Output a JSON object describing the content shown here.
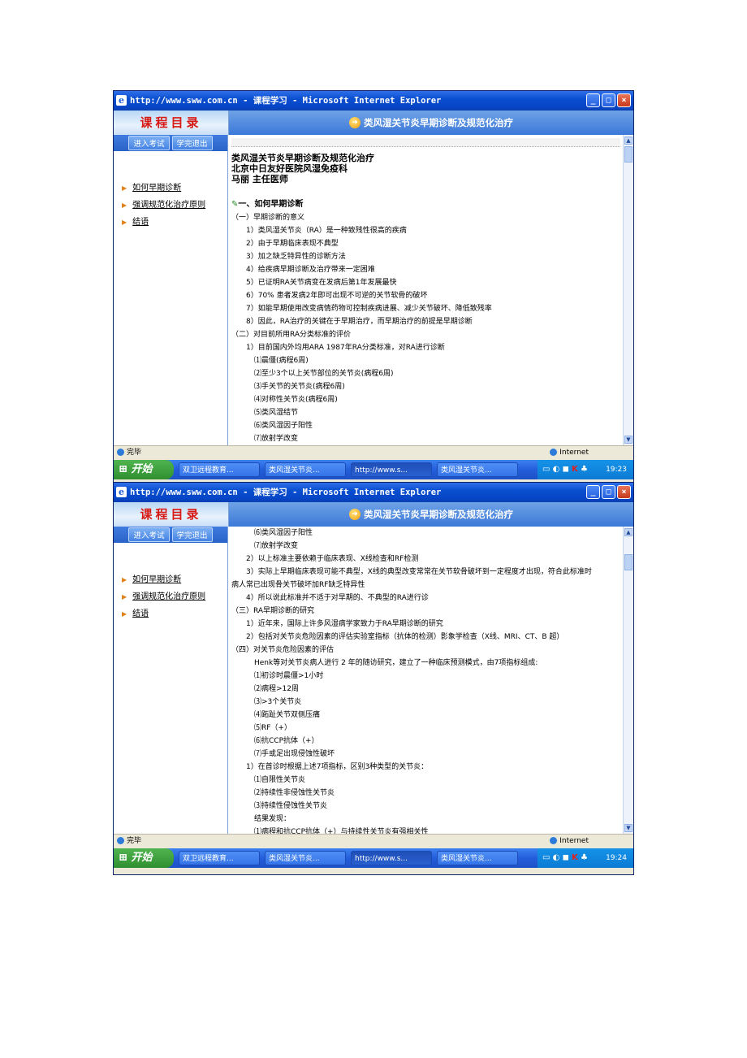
{
  "window": {
    "title": "http://www.sww.com.cn - 课程学习 - Microsoft Internet Explorer",
    "minimize": "_",
    "maximize": "□",
    "close": "×"
  },
  "app": {
    "menu_heading": "课程目录",
    "course_title": "类风湿关节炎早期诊断及规范化治疗",
    "buttons": {
      "exam": "进入考试",
      "exit": "学完退出"
    },
    "nav": [
      "如何早期诊断",
      "强调规范化治疗原则",
      "结语"
    ]
  },
  "content1": {
    "title1": "类风湿关节炎早期诊断及规范化治疗",
    "title2": "北京中日友好医院风湿免疫科",
    "title3": "马丽  主任医师",
    "section_heading": "一、如何早期诊断",
    "lines": [
      "（一）早期诊断的意义",
      "1）类风湿关节炎（RA）是一种致残性很高的疾病",
      "2）由于早期临床表现不典型",
      "3）加之缺乏特异性的诊断方法",
      "4）给疾病早期诊断及治疗带来一定困难",
      "5）已证明RA关节病变在发病后第1年发展最快",
      "6）70% 患者发病2年即可出现不可逆的关节软骨的破坏",
      "7）如能早期使用改变病情药物可控制疾病进展、减少关节破坏、降低致残率",
      "8）因此，RA治疗的关键在于早期治疗，而早期治疗的前提是早期诊断",
      "（二）对目前所用RA分类标准的评价",
      "1）目前国内外均用ARA 1987年RA分类标准，对RA进行诊断",
      "⑴晨僵(病程6周)",
      "⑵至少3个以上关节部位的关节炎(病程6周)",
      "⑶手关节的关节炎(病程6周)",
      "⑷对称性关节炎(病程6周)",
      "⑸类风湿结节",
      "⑹类风湿因子阳性",
      "⑺放射学改变"
    ]
  },
  "content2": {
    "lines": [
      "⑹类风湿因子阳性",
      "⑺放射学改变",
      "2）以上标准主要依赖于临床表现、X线检查和RF检测",
      "3）实际上早期临床表现可能不典型，X线的典型改变常常在关节软骨破坏到一定程度才出现，符合此标准时",
      "病人常已出现骨关节破坏加RF缺乏特异性",
      "4）所以说此标准并不适于对早期的、不典型的RA进行诊",
      "（三）RA早期诊断的研究",
      "1）近年来，国际上许多风湿病学家致力于RA早期诊断的研究",
      "2）包括对关节炎危险因素的评估实验室指标（抗体的检测）影象学检查（X线、MRI、CT、B 超）",
      "（四）对关节炎危险因素的评估",
      "Henk等对关节炎病人进行 2 年的随访研究，建立了一种临床预测模式，由7项指标组成:",
      "⑴初诊时晨僵>1小时",
      "⑵病程>12周",
      "⑶>3个关节炎",
      "⑷跖趾关节双侧压痛",
      "⑸RF（+）",
      "⑹抗CCP抗体（+）",
      "⑺手或足出现侵蚀性破坏",
      "1）在首诊时根据上述7项指标，区别3种类型的关节炎：",
      "⑴自限性关节炎",
      "⑵持续性非侵蚀性关节炎",
      "⑶持续性侵蚀性关节炎",
      "结果发现：",
      "⑴病程和抗CCP抗体（+）与持续性关节炎有强相关性"
    ]
  },
  "status": {
    "done": "完毕",
    "zone": "Internet"
  },
  "taskbar": {
    "start": "开始",
    "tasks": [
      "双卫远程教育...",
      "类风湿关节炎...",
      "http://www.s...",
      "类风湿关节炎..."
    ],
    "time1": "19:23",
    "time2": "19:24"
  },
  "colors": {
    "titlebar": "#0645c7",
    "menu_heading": "#d81a14",
    "accent_orange": "#f3a10d"
  }
}
